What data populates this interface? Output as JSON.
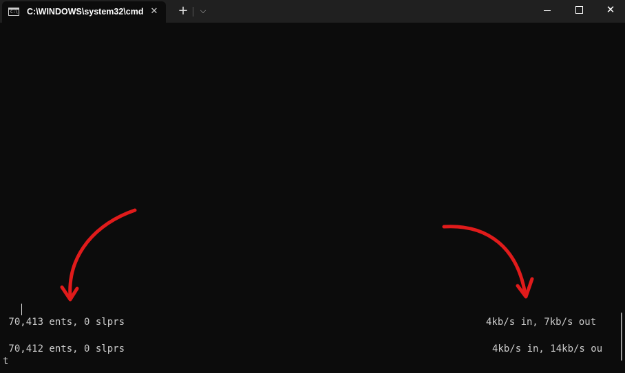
{
  "window": {
    "tab_title": "C:\\WINDOWS\\system32\\cmd.",
    "tab_icon_text": "C:\\."
  },
  "titlebar": {
    "close_tab_glyph": "✕",
    "new_tab_glyph": "+",
    "dropdown_glyph": "⌵",
    "minimize_label": "",
    "maximize_label": "",
    "close_glyph": "✕"
  },
  "terminal": {
    "lines": {
      "left_1": " 70,413 ents, 0 slprs",
      "right_1": "4kb/s in, 7kb/s out ",
      "left_2": " 70,412 ents, 0 slprs",
      "right_2": "4kb/s in, 14kb/s ou",
      "wrap_2": "t"
    }
  },
  "colors": {
    "terminal_bg": "#0c0c0c",
    "titlebar_bg": "#202020",
    "text": "#cccccc",
    "annotation": "#e01b1b"
  }
}
